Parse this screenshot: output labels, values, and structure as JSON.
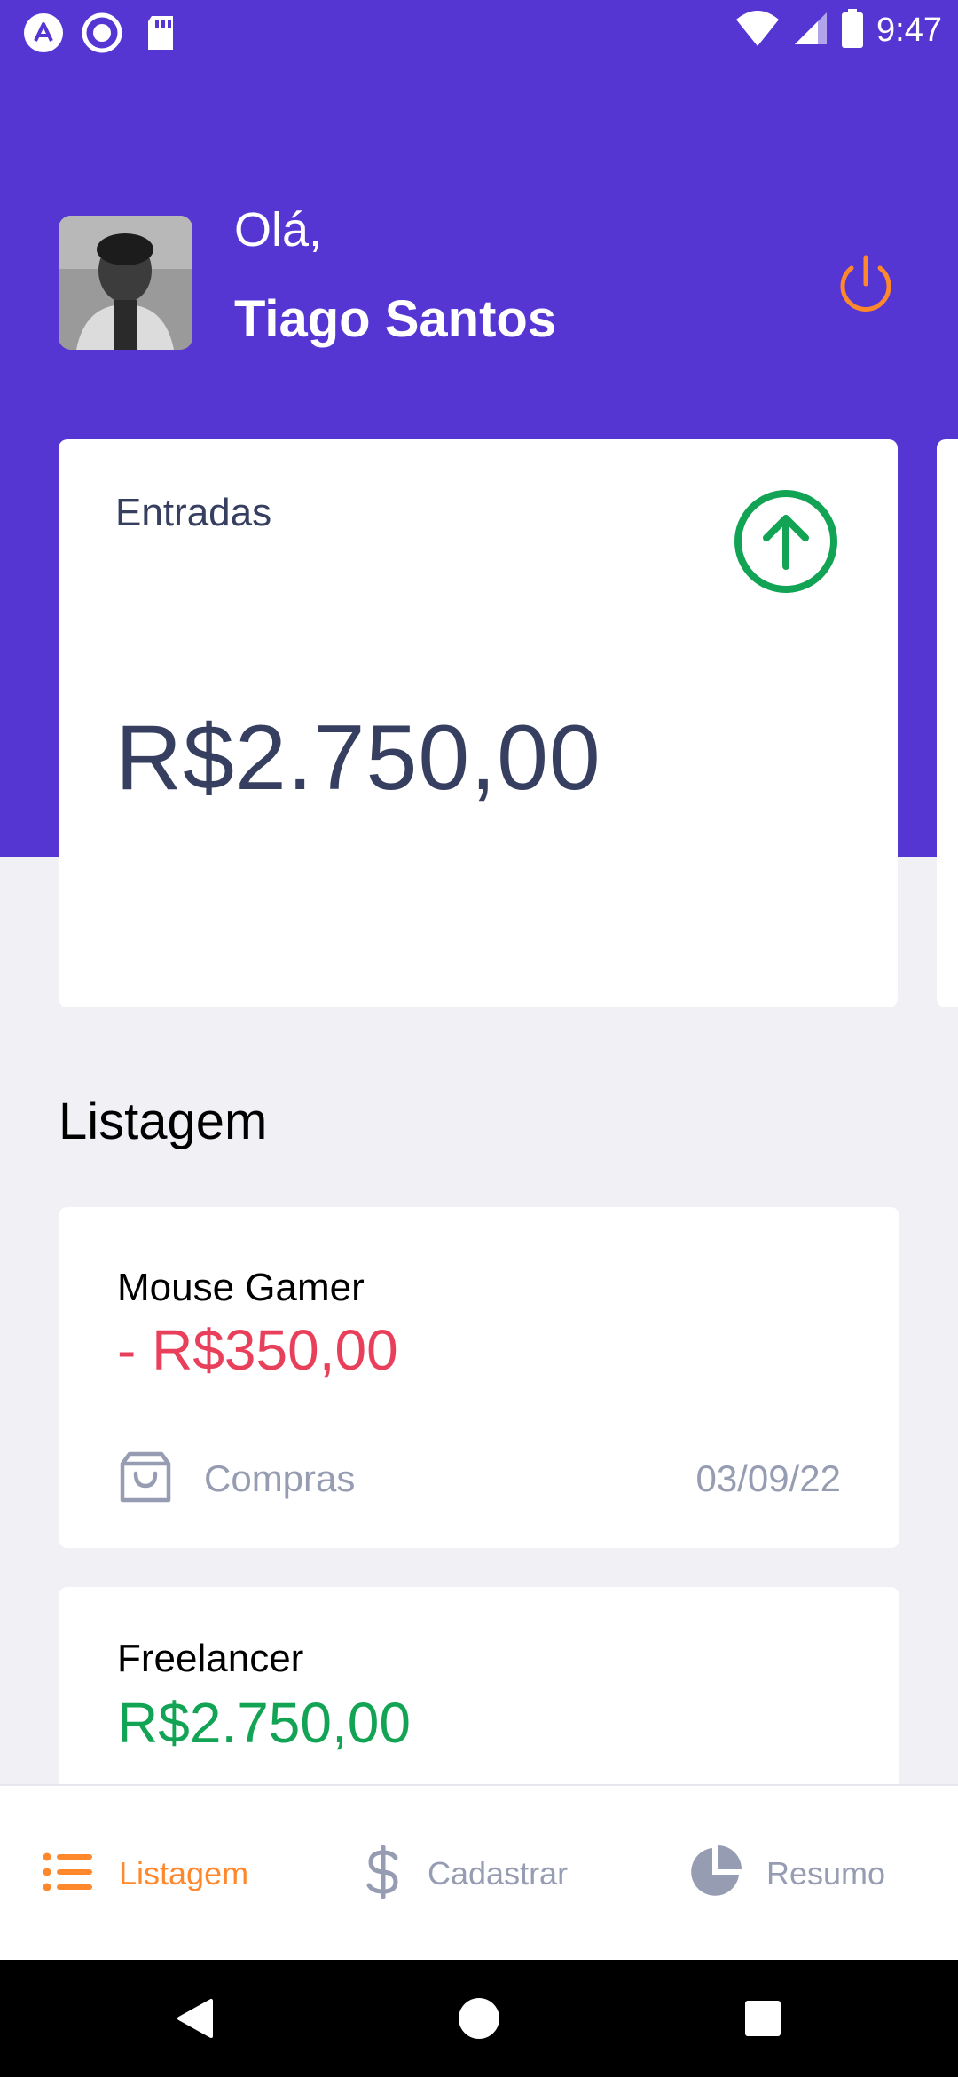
{
  "status_bar": {
    "time": "9:47",
    "left_icons": [
      "app-logo-icon",
      "record-icon",
      "sd-card-icon"
    ],
    "right_icons": [
      "wifi-icon",
      "signal-icon",
      "battery-icon"
    ]
  },
  "header": {
    "greeting": "Olá,",
    "user_name": "Tiago Santos"
  },
  "highlight_card": {
    "title": "Entradas",
    "amount": "R$2.750,00",
    "icon": "arrow-up-circle-icon"
  },
  "section_title": "Listagem",
  "transactions": [
    {
      "title": "Mouse Gamer",
      "amount": "- R$350,00",
      "category": "Compras",
      "category_icon": "shopping-bag-icon",
      "date": "03/09/22"
    },
    {
      "title": "Freelancer",
      "amount": "R$2.750,00"
    }
  ],
  "tabs": [
    {
      "label": "Listagem",
      "icon": "list-icon",
      "active": true
    },
    {
      "label": "Cadastrar",
      "icon": "dollar-icon",
      "active": false
    },
    {
      "label": "Resumo",
      "icon": "pie-chart-icon",
      "active": false
    }
  ],
  "colors": {
    "primary": "#5636D3",
    "secondary": "#FF872C",
    "success": "#12A454",
    "attention": "#E83F5B",
    "text_dark": "#363F5F",
    "text_light": "#969CB2",
    "background": "#F0F0F5"
  }
}
